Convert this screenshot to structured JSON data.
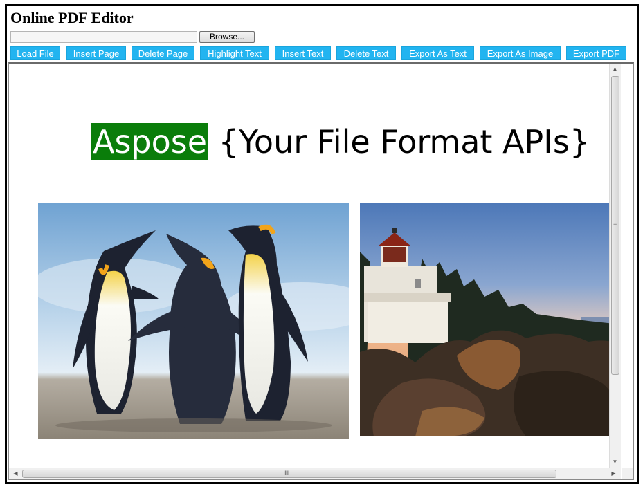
{
  "app": {
    "title": "Online PDF Editor"
  },
  "file_input": {
    "value": "",
    "browse_label": "Browse..."
  },
  "toolbar": {
    "buttons": [
      {
        "label": "Load File"
      },
      {
        "label": "Insert Page"
      },
      {
        "label": "Delete Page"
      },
      {
        "label": "Highlight Text"
      },
      {
        "label": "Insert Text"
      },
      {
        "label": "Delete Text"
      },
      {
        "label": "Export As Text"
      },
      {
        "label": "Export As Image"
      },
      {
        "label": "Export PDF"
      }
    ],
    "button_color": "#22b4f0"
  },
  "document": {
    "highlighted_word": "Aspose",
    "heading_rest": "{Your File Format APIs}",
    "highlight_color": "#0a7d0a",
    "images": [
      {
        "icon": "penguins-photo"
      },
      {
        "icon": "lighthouse-photo"
      }
    ]
  }
}
